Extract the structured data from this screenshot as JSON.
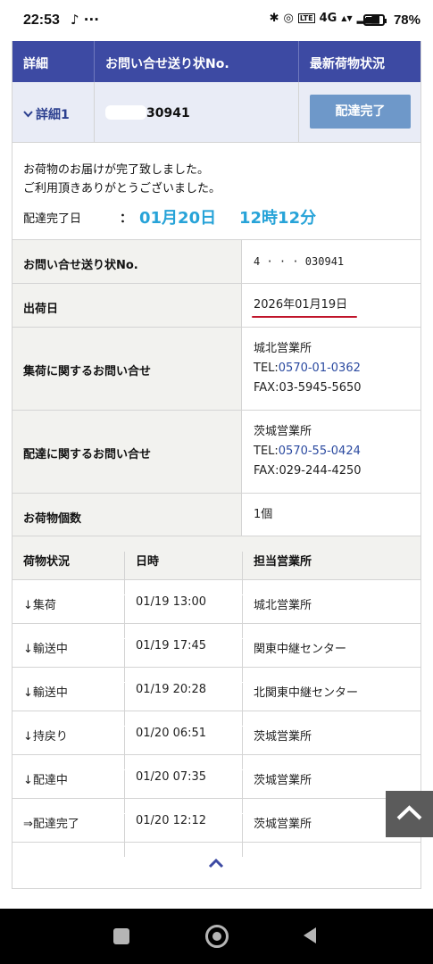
{
  "status_bar": {
    "time": "22:53",
    "left_icons": "♪ ···",
    "right_icons": [
      "✱",
      "◎",
      "LTE",
      "4G",
      "▲▼",
      "▂▄▆"
    ],
    "battery_percent": "78%",
    "battery_level": 0.78
  },
  "header": {
    "col_detail": "詳細",
    "col_tracking": "お問い合せ送り状No.",
    "col_status": "最新荷物状況"
  },
  "detail": {
    "toggle_label": "詳細1",
    "tracking_no_visible": "30941",
    "status_button": "配達完了"
  },
  "message": {
    "line1": "お荷物のお届けが完了致しました。",
    "line2": "ご利用頂きありがとうございました。",
    "done_label": "配達完了日",
    "colon": "：",
    "done_date": "01月20日",
    "done_time": "12時12分"
  },
  "info": {
    "tracking_label": "お問い合せ送り状No.",
    "tracking_value": "4  ·  ·  ·  030941",
    "ship_date_label": "出荷日",
    "ship_date_value": "2026年01月19日",
    "pickup_label": "集荷に関するお問い合せ",
    "pickup_office": "城北営業所",
    "pickup_tel_prefix": "TEL:",
    "pickup_tel": "0570-01-0362",
    "pickup_fax": "FAX:03-5945-5650",
    "delivery_label": "配達に関するお問い合せ",
    "delivery_office": "茨城営業所",
    "delivery_tel_prefix": "TEL:",
    "delivery_tel": "0570-55-0424",
    "delivery_fax": "FAX:029-244-4250",
    "count_label": "お荷物個数",
    "count_value": "1個"
  },
  "history": {
    "headers": [
      "荷物状況",
      "日時",
      "担当営業所"
    ],
    "rows": [
      {
        "status": "↓集荷",
        "datetime": "01/19 13:00",
        "office": "城北営業所"
      },
      {
        "status": "↓輸送中",
        "datetime": "01/19 17:45",
        "office": "関東中継センター"
      },
      {
        "status": "↓輸送中",
        "datetime": "01/19 20:28",
        "office": "北関東中継センター"
      },
      {
        "status": "↓持戻り",
        "datetime": "01/20 06:51",
        "office": "茨城営業所"
      },
      {
        "status": "↓配達中",
        "datetime": "01/20 07:35",
        "office": "茨城営業所"
      },
      {
        "status": "⇒配達完了",
        "datetime": "01/20 12:12",
        "office": "茨城営業所"
      }
    ]
  },
  "colors": {
    "header_bg": "#3d4aa3",
    "status_button_bg": "#6e98c9",
    "accent_blue": "#27a3d8",
    "underline_red": "#c0142a"
  }
}
